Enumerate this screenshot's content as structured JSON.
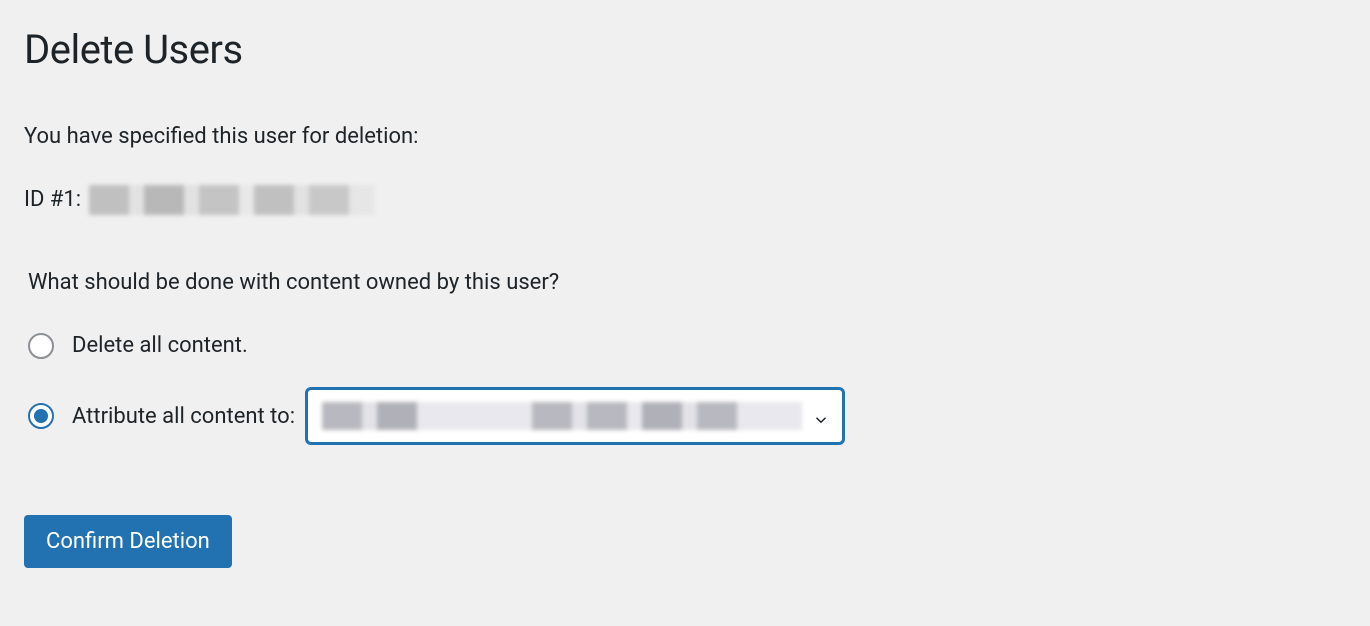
{
  "page": {
    "title": "Delete Users",
    "intro": "You have specified this user for deletion:",
    "user_prefix": "ID #1:",
    "legend": "What should be done with content owned by this user?",
    "options": {
      "delete_all": "Delete all content.",
      "attribute": "Attribute all content to:"
    },
    "selected_option": "attribute",
    "confirm_button": "Confirm Deletion"
  }
}
